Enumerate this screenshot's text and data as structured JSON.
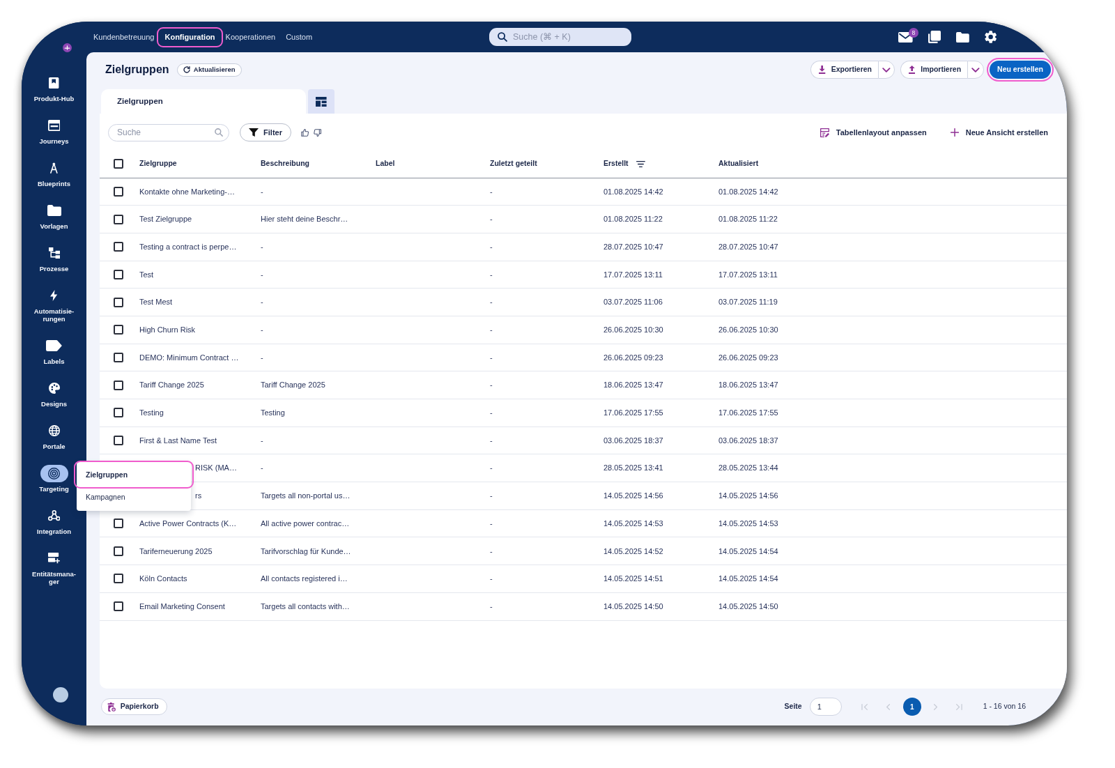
{
  "top_nav": {
    "tabs": [
      {
        "label": "Kundenbetreuung",
        "selected": false,
        "highlighted": false
      },
      {
        "label": "Konfiguration",
        "selected": true,
        "highlighted": true
      },
      {
        "label": "Kooperationen",
        "selected": false,
        "highlighted": false
      },
      {
        "label": "Custom",
        "selected": false,
        "highlighted": false
      }
    ],
    "search": {
      "placeholder": "Suche (⌘ + K)"
    },
    "mail_badge": "8"
  },
  "sidebar": {
    "items": [
      {
        "label": "Produkt-Hub",
        "selected": false
      },
      {
        "label": "Journeys",
        "selected": false
      },
      {
        "label": "Blueprints",
        "selected": false
      },
      {
        "label": "Vorlagen",
        "selected": false
      },
      {
        "label": "Prozesse",
        "selected": false
      },
      {
        "label": "Automatisie-rungen",
        "selected": false
      },
      {
        "label": "Labels",
        "selected": false
      },
      {
        "label": "Designs",
        "selected": false
      },
      {
        "label": "Portale",
        "selected": false
      },
      {
        "label": "Targeting",
        "selected": true
      },
      {
        "label": "Integration",
        "selected": false
      },
      {
        "label": "Entitätsmana-ger",
        "selected": false
      }
    ]
  },
  "flyout_menu": {
    "items": [
      {
        "label": "Zielgruppen",
        "selected": true,
        "highlighted": true
      },
      {
        "label": "Kampagnen",
        "selected": false,
        "highlighted": false
      }
    ]
  },
  "header": {
    "title": "Zielgruppen",
    "refresh_button": "Aktualisieren",
    "buttons": [
      {
        "label": "Exportieren",
        "kind": "export",
        "highlighted": false
      },
      {
        "label": "Importieren",
        "kind": "import",
        "highlighted": false
      },
      {
        "label": "Neu erstellen",
        "kind": "primary",
        "highlighted": true
      }
    ]
  },
  "view_tabs": [
    {
      "label": "Zielgruppen",
      "selected": true
    }
  ],
  "toolbar": {
    "search": {
      "placeholder": "Suche"
    },
    "filter_button": "Filter",
    "actions": [
      {
        "label": "Tabellenlayout anpassen",
        "kind": "layout"
      },
      {
        "label": "Neue Ansicht erstellen",
        "kind": "add"
      }
    ]
  },
  "table": {
    "select_all_checked": false,
    "columns": [
      {
        "label": "Zielgruppe",
        "sorted": false
      },
      {
        "label": "Beschreibung",
        "sorted": false
      },
      {
        "label": "Label",
        "sorted": false
      },
      {
        "label": "Zuletzt geteilt",
        "sorted": false
      },
      {
        "label": "Erstellt",
        "sorted": true
      },
      {
        "label": "Aktualisiert",
        "sorted": false
      }
    ],
    "rows": [
      {
        "name": "Kontakte ohne Marketing-…",
        "description": "-",
        "last_shared": "-",
        "created": "01.08.2025 14:42",
        "updated": "01.08.2025 14:42",
        "checked": false
      },
      {
        "name": "Test Zielgruppe",
        "description": "Hier steht deine Beschr…",
        "last_shared": "-",
        "created": "01.08.2025 11:22",
        "updated": "01.08.2025 11:22",
        "checked": false
      },
      {
        "name": "Testing a contract is perpe…",
        "description": "-",
        "last_shared": "-",
        "created": "28.07.2025 10:47",
        "updated": "28.07.2025 10:47",
        "checked": false
      },
      {
        "name": "Test",
        "description": "-",
        "last_shared": "-",
        "created": "17.07.2025 13:11",
        "updated": "17.07.2025 13:11",
        "checked": false
      },
      {
        "name": "Test Mest",
        "description": "-",
        "last_shared": "-",
        "created": "03.07.2025 11:06",
        "updated": "03.07.2025 11:19",
        "checked": false
      },
      {
        "name": "High Churn Risk",
        "description": "-",
        "last_shared": "-",
        "created": "26.06.2025 10:30",
        "updated": "26.06.2025 10:30",
        "checked": false
      },
      {
        "name": "DEMO: Minimum Contract …",
        "description": "-",
        "last_shared": "-",
        "created": "26.06.2025 09:23",
        "updated": "26.06.2025 09:23",
        "checked": false
      },
      {
        "name": "Tariff Change 2025",
        "description": "Tariff Change 2025",
        "last_shared": "-",
        "created": "18.06.2025 13:47",
        "updated": "18.06.2025 13:47",
        "checked": false
      },
      {
        "name": "Testing",
        "description": "Testing",
        "last_shared": "-",
        "created": "17.06.2025 17:55",
        "updated": "17.06.2025 17:55",
        "checked": false
      },
      {
        "name": "First & Last Name Test",
        "description": "-",
        "last_shared": "-",
        "created": "03.06.2025 18:37",
        "updated": "03.06.2025 18:37",
        "checked": false
      },
      {
        "name": "RISK (MA…",
        "covered_by_menu": true,
        "description": "-",
        "last_shared": "-",
        "created": "28.05.2025 13:41",
        "updated": "28.05.2025 13:44"
      },
      {
        "name": "rs",
        "covered_by_menu": true,
        "description": "Targets all non-portal us…",
        "last_shared": "-",
        "created": "14.05.2025 14:56",
        "updated": "14.05.2025 14:56"
      },
      {
        "name": "Active Power Contracts (K…",
        "description": "All active power contrac…",
        "last_shared": "-",
        "created": "14.05.2025 14:53",
        "updated": "14.05.2025 14:53",
        "checked": false
      },
      {
        "name": "Tariferneuerung 2025",
        "description": "Tarifvorschlag für Kunde…",
        "last_shared": "-",
        "created": "14.05.2025 14:52",
        "updated": "14.05.2025 14:54",
        "checked": false
      },
      {
        "name": "Köln Contacts",
        "description": "All contacts registered i…",
        "last_shared": "-",
        "created": "14.05.2025 14:51",
        "updated": "14.05.2025 14:54",
        "checked": false
      },
      {
        "name": "Email Marketing Consent",
        "description": "Targets all contacts with…",
        "last_shared": "-",
        "created": "14.05.2025 14:50",
        "updated": "14.05.2025 14:50",
        "checked": false
      }
    ]
  },
  "footer": {
    "trash_button": "Papierkorb",
    "page_label": "Seite",
    "page_input": "1",
    "pager_buttons": [
      {
        "kind": "first",
        "disabled": true
      },
      {
        "kind": "prev",
        "disabled": true
      },
      {
        "kind": "page",
        "label": "1",
        "selected": true
      },
      {
        "kind": "next",
        "disabled": true
      },
      {
        "kind": "last",
        "disabled": true
      }
    ],
    "range": "1 - 16 von 16"
  }
}
